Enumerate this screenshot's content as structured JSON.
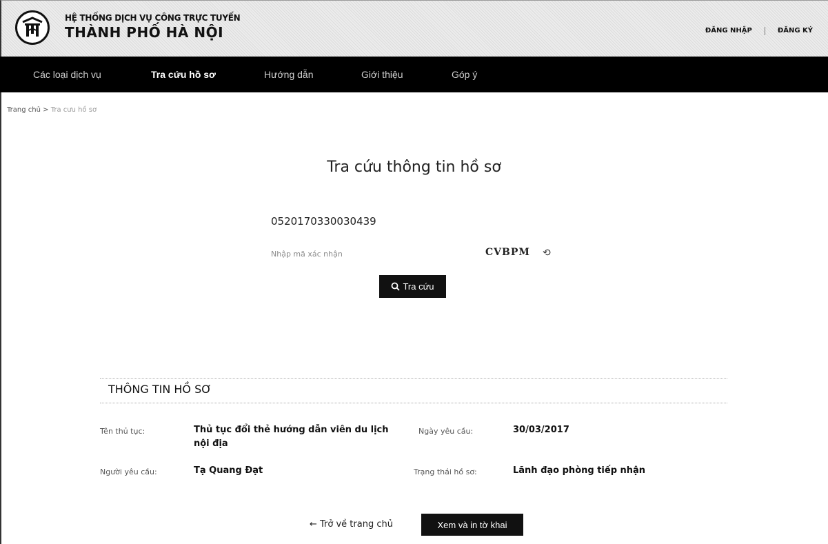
{
  "header": {
    "brand_top": "HỆ THỐNG DỊCH VỤ CÔNG TRỰC TUYẾN",
    "brand_main": "THÀNH PHỐ HÀ NỘI",
    "login": "ĐĂNG NHẬP",
    "register": "ĐĂNG KÝ"
  },
  "nav": {
    "items": [
      {
        "label": "Các loại dịch vụ"
      },
      {
        "label": "Tra cứu hồ sơ",
        "active": true
      },
      {
        "label": "Hướng dẫn"
      },
      {
        "label": "Giới thiệu"
      },
      {
        "label": "Góp ý"
      }
    ]
  },
  "breadcrumb": {
    "home": "Trang chủ",
    "separator": ">",
    "current": "Tra cưu hồ sơ"
  },
  "search": {
    "title": "Tra cứu thông tin hồ sơ",
    "code_value": "0520170330030439",
    "captcha_placeholder": "Nhập mã xác nhận",
    "captcha_text": "CVBPM",
    "button_icon": "search-icon",
    "button_label": "Tra cứu"
  },
  "record": {
    "section_title": "THÔNG TIN HỒ SƠ",
    "procedure_label": "Tên thủ tục:",
    "procedure_value": "Thủ tục đổi thẻ hướng dẫn viên du lịch nội địa",
    "request_date_label": "Ngày yêu cầu:",
    "request_date_value": "30/03/2017",
    "requester_label": "Người yêu cầu:",
    "requester_value": "Tạ Quang Đạt",
    "status_label": "Trạng thái hồ sơ:",
    "status_value": "Lãnh đạo phòng tiếp nhận"
  },
  "actions": {
    "back_label": "← Trở về trang chủ",
    "print_label": "Xem và in tờ khai"
  },
  "colors": {
    "nav_bg": "#000000",
    "button_bg": "#111111"
  }
}
